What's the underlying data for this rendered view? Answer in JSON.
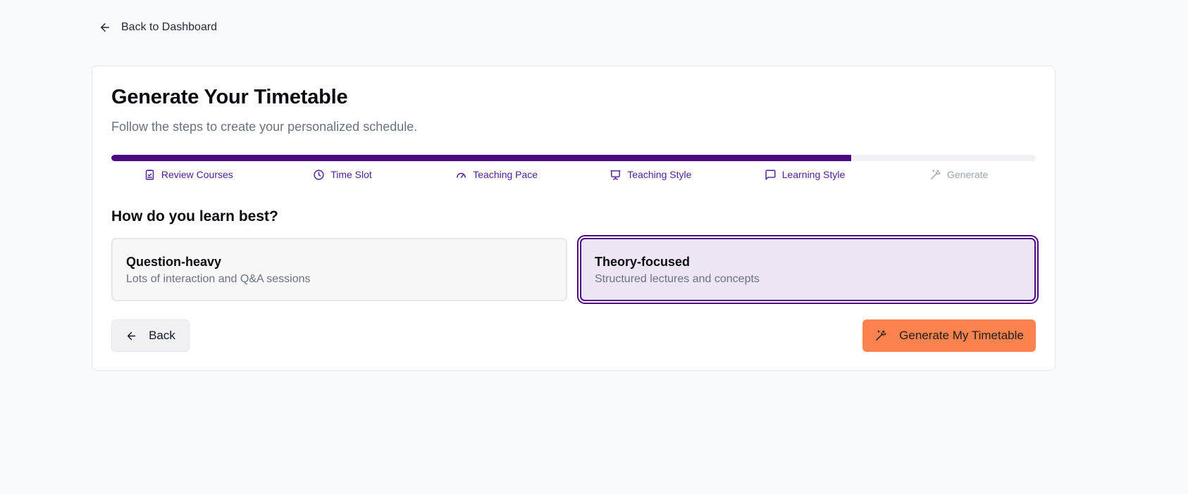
{
  "nav": {
    "back_label": "Back to Dashboard",
    "back_icon": "arrow-left-icon"
  },
  "header": {
    "title": "Generate Your Timetable",
    "subtitle": "Follow the steps to create your personalized schedule."
  },
  "progress": {
    "fraction": 0.8,
    "current_step": 5,
    "total_steps": 6
  },
  "steps": [
    {
      "label": "Review Courses",
      "icon": "clipboard-check-icon",
      "status": "done"
    },
    {
      "label": "Time Slot",
      "icon": "clock-icon",
      "status": "done"
    },
    {
      "label": "Teaching Pace",
      "icon": "gauge-icon",
      "status": "done"
    },
    {
      "label": "Teaching Style",
      "icon": "presentation-icon",
      "status": "done"
    },
    {
      "label": "Learning Style",
      "icon": "message-square-icon",
      "status": "current"
    },
    {
      "label": "Generate",
      "icon": "wand-icon",
      "status": "pending"
    }
  ],
  "question": {
    "text": "How do you learn best?"
  },
  "options": [
    {
      "title": "Question-heavy",
      "description": "Lots of interaction and Q&A sessions",
      "selected": false
    },
    {
      "title": "Theory-focused",
      "description": "Structured lectures and concepts",
      "selected": true
    }
  ],
  "actions": {
    "back_label": "Back",
    "generate_label": "Generate My Timetable"
  },
  "colors": {
    "accent": "#4c0a82",
    "generate_button": "#fc8350",
    "selected_bg": "#ede5f3",
    "background": "#f9fafb"
  }
}
